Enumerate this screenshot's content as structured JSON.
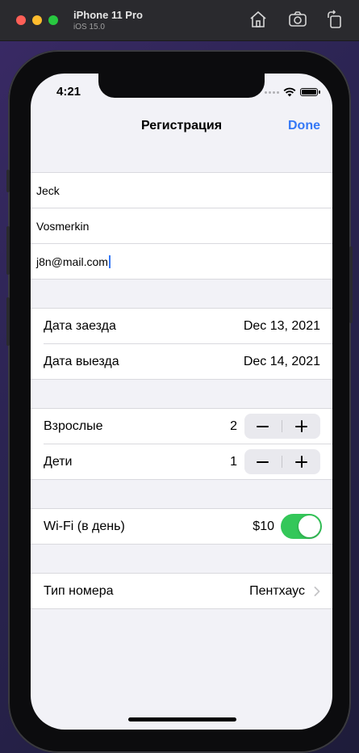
{
  "simulator": {
    "device_name": "iPhone 11 Pro",
    "os_version": "iOS 15.0"
  },
  "status_bar": {
    "time": "4:21"
  },
  "nav": {
    "title": "Регистрация",
    "done_label": "Done"
  },
  "guest": {
    "first_name": "Jeck",
    "last_name": "Vosmerkin",
    "email": "j8n@mail.com"
  },
  "dates": {
    "check_in_label": "Дата заезда",
    "check_in_value": "Dec 13, 2021",
    "check_out_label": "Дата выезда",
    "check_out_value": "Dec 14, 2021"
  },
  "guests_count": {
    "adults_label": "Взрослые",
    "adults_value": "2",
    "children_label": "Дети",
    "children_value": "1"
  },
  "wifi": {
    "label": "Wi-Fi (в день)",
    "price": "$10",
    "enabled": true
  },
  "room": {
    "label": "Тип номера",
    "value": "Пентхаус"
  },
  "colors": {
    "accent": "#3478f6",
    "toggle_on": "#34c759",
    "background": "#f2f2f7"
  }
}
